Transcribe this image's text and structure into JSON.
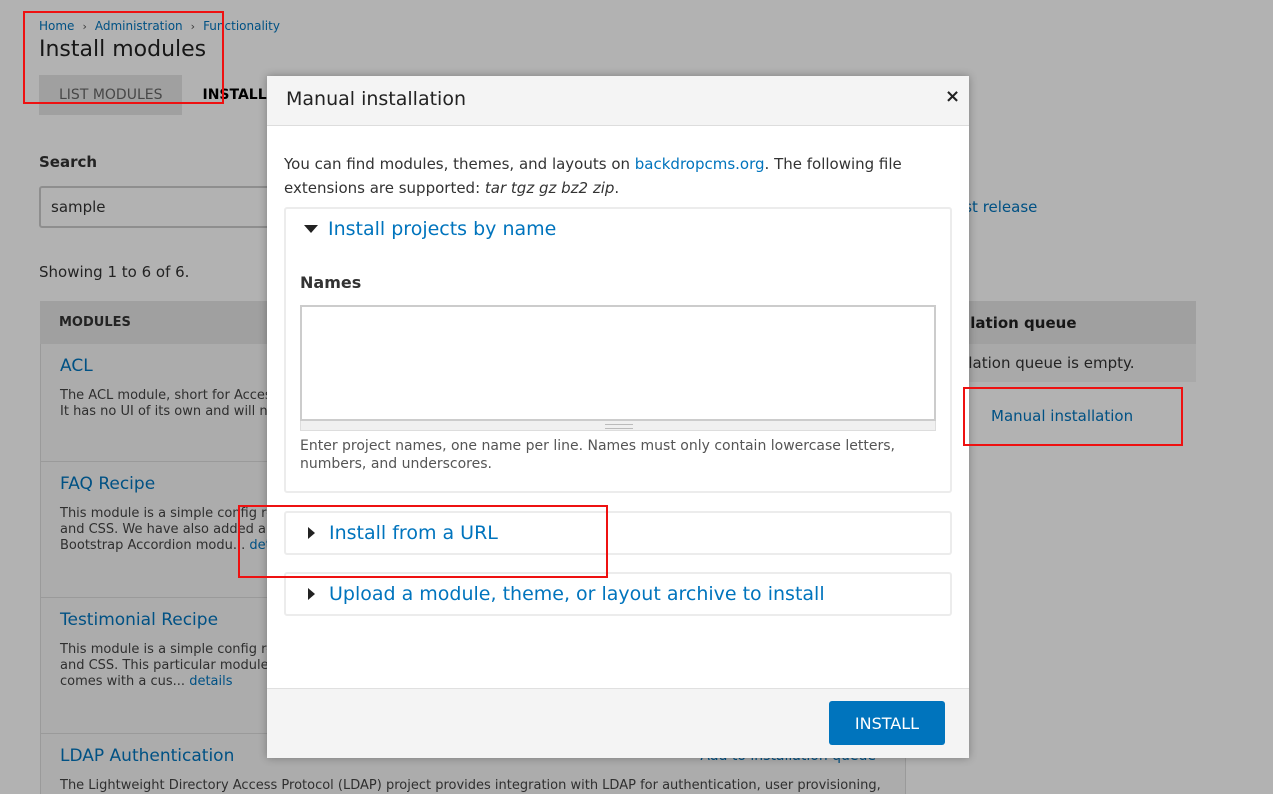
{
  "breadcrumb": {
    "home": "Home",
    "administration": "Administration",
    "functionality": "Functionality"
  },
  "page": {
    "title": "Install modules"
  },
  "tabs": {
    "list": "LIST MODULES",
    "install": "INSTALL"
  },
  "search": {
    "label": "Search",
    "value": "sample",
    "latest_release_link": "est release"
  },
  "results": {
    "showing": "Showing 1 to 6 of 6."
  },
  "modules": {
    "header": "MODULES",
    "add_label": "Add to installation queue",
    "details_label": "details",
    "rows": [
      {
        "name": "ACL",
        "desc_line1": "The ACL module, short for Access",
        "desc_line2": "It has no UI of its own and will no"
      },
      {
        "name": "FAQ Recipe",
        "desc_line1": "This module is a simple config re",
        "desc_line2": "and CSS. We have also added an",
        "desc_line3": "Bootstrap Accordion modu...",
        "details": "deta"
      },
      {
        "name": "Testimonial Recipe",
        "desc_line1": "This module is a simple config re",
        "desc_line2": "and CSS. This particular module c",
        "desc_line3": "comes with a cus...",
        "details": "details"
      },
      {
        "name": "LDAP Authentication",
        "desc_line1": "The Lightweight Directory Access Protocol (LDAP) project provides integration with LDAP for authentication, user provisioning,"
      }
    ]
  },
  "queue": {
    "header": "allation queue",
    "empty_text": "allation queue is empty.",
    "manual_link": "Manual installation"
  },
  "dialog": {
    "title": "Manual installation",
    "close_glyph": "×",
    "intro_prefix": "You can find modules, themes, and layouts on ",
    "intro_link": "backdropcms.org",
    "intro_suffix": ". The following file extensions are supported: ",
    "extensions": "tar tgz gz bz2 zip",
    "intro_end": ".",
    "section_names": {
      "title": "Install projects by name",
      "label": "Names",
      "help": "Enter project names, one name per line. Names must only contain lowercase letters, numbers, and underscores."
    },
    "section_url": {
      "title": "Install from a URL"
    },
    "section_upload": {
      "title": "Upload a module, theme, or layout archive to install"
    },
    "install_button": "INSTALL"
  },
  "colors": {
    "link": "#0074bd",
    "button": "#0074bd",
    "annotation": "#ee1111"
  }
}
